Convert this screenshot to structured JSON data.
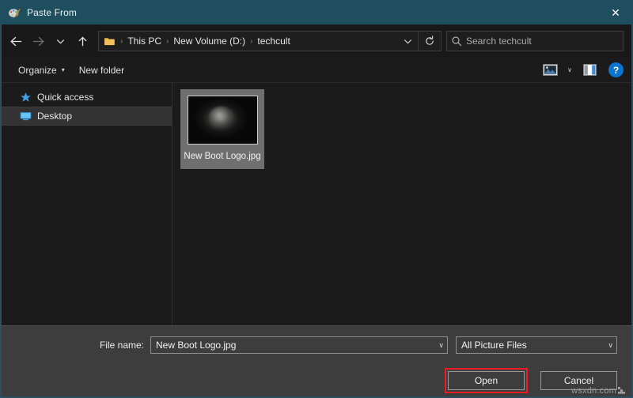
{
  "window": {
    "title": "Paste From",
    "app_icon": "paint-palette-icon",
    "close_label": "✕",
    "title_bar_color": "#1f4e5f"
  },
  "navigation": {
    "back_label": "←",
    "forward_label": "→",
    "recent_label": "∨",
    "up_label": "↑",
    "breadcrumb": {
      "folder_icon": "folder-icon",
      "separator": "›",
      "crumbs": [
        "This PC",
        "New Volume (D:)",
        "techcult"
      ]
    },
    "address_dropdown_label": "∨",
    "refresh_label": "↻"
  },
  "search": {
    "placeholder": "Search techcult",
    "value": "",
    "icon": "search-icon"
  },
  "toolbar": {
    "organize_label": "Organize",
    "organize_caret": "▾",
    "new_folder_label": "New folder",
    "view_icon": "picture-view-icon",
    "view_caret": "∨",
    "preview_pane_icon": "preview-pane-icon",
    "help_label": "?"
  },
  "sidebar": {
    "items": [
      {
        "label": "Quick access",
        "icon": "star-icon",
        "selected": false
      },
      {
        "label": "Desktop",
        "icon": "monitor-icon",
        "selected": true
      }
    ]
  },
  "file_pane": {
    "items": [
      {
        "name": "New Boot Logo.jpg",
        "selected": true,
        "thumbnail": "dark-cat-photo-thumbnail"
      }
    ]
  },
  "bottom": {
    "filename_label": "File name:",
    "filename_value": "New Boot Logo.jpg",
    "filename_caret": "∨",
    "filetype_value": "All Picture Files",
    "filetype_caret": "∨",
    "open_label": "Open",
    "cancel_label": "Cancel",
    "highlight_color": "#ef1c22"
  },
  "watermark": {
    "text": "wsxdn.com"
  }
}
